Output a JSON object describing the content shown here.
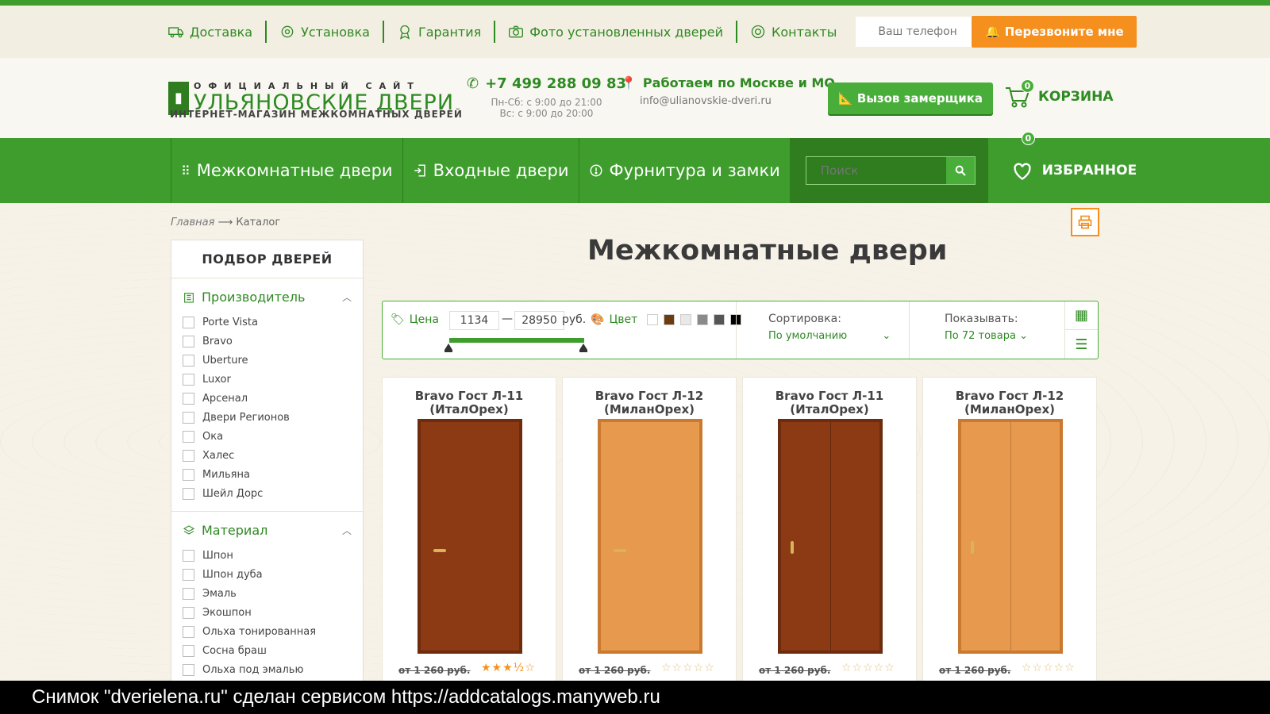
{
  "topnav": {
    "items": [
      {
        "label": "Доставка",
        "icon": "truck-icon"
      },
      {
        "label": "Установка",
        "icon": "gear-icon"
      },
      {
        "label": "Гарантия",
        "icon": "award-icon"
      },
      {
        "label": "Фото установленных дверей",
        "icon": "camera-icon"
      },
      {
        "label": "Контакты",
        "icon": "at-icon"
      }
    ],
    "phone_placeholder": "Ваш телефон",
    "callback_label": "Перезвоните мне"
  },
  "logo": {
    "top": "ОФИЦИАЛЬНЫЙ САЙТ",
    "main": "УЛЬЯНОВСКИЕ ДВЕРИ",
    "sub": "ИНТЕРНЕТ-МАГАЗИН МЕЖКОМНАТНЫХ ДВЕРЕЙ"
  },
  "contact": {
    "phone": "+7 499 288 09 83",
    "hours1": "Пн-Сб: с 9:00 до 21:00",
    "hours2": "Вс: с 9:00 до 20:00"
  },
  "address": {
    "title": "Работаем по Москве и МО",
    "email": "info@ulianovskie-dveri.ru"
  },
  "measure_label": "Вызов замерщика",
  "cart": {
    "label": "КОРЗИНА",
    "count": "0"
  },
  "mainnav": {
    "items": [
      "Межкомнатные двери",
      "Входные двери",
      "Фурнитура и замки"
    ],
    "search_placeholder": "Поиск",
    "fav_label": "ИЗБРАННОЕ",
    "fav_count": "0"
  },
  "breadcrumb": {
    "home": "Главная",
    "arrow": "⟶",
    "current": "Каталог"
  },
  "sidebar": {
    "title": "ПОДБОР ДВЕРЕЙ",
    "sections": [
      {
        "title": "Производитель",
        "options": [
          "Porte Vista",
          "Bravo",
          "Uberture",
          "Luxor",
          "Арсенал",
          "Двери Регионов",
          "Ока",
          "Халес",
          "Мильяна",
          "Шейл Дорс"
        ]
      },
      {
        "title": "Материал",
        "options": [
          "Шпон",
          "Шпон дуба",
          "Эмаль",
          "Экошпон",
          "Ольха тонированная",
          "Сосна браш",
          "Ольха под эмалью"
        ]
      }
    ]
  },
  "page_title": "Межкомнатные двери",
  "filters": {
    "price_label": "Цена",
    "price_min": "1134",
    "dash": "—",
    "price_max": "28950",
    "currency": "руб.",
    "color_label": "Цвет",
    "swatches": [
      "#ffffff",
      "#6b3c12",
      "#e8e8e8",
      "#8a8a8a",
      "#555555",
      "#000000"
    ],
    "sort_label": "Сортировка:",
    "sort_value": "По умолчанию",
    "show_label": "Показывать:",
    "show_value": "По 72 товара"
  },
  "products": [
    {
      "name1": "Bravo Гост Л-11",
      "name2": "(ИталОрех)",
      "price": "от 1 260 руб.",
      "door_color": "#8c3a14",
      "frame_color": "#6e2c0e",
      "stars": "★★★½☆"
    },
    {
      "name1": "Bravo Гост Л-12",
      "name2": "(МиланОрех)",
      "price": "от 1 260 руб.",
      "door_color": "#e79a4d",
      "frame_color": "#c97a30",
      "stars": "☆☆☆☆☆"
    },
    {
      "name1": "Bravo Гост Л-11",
      "name2": "(ИталОрех)",
      "price": "от 1 260 руб.",
      "door_color": "#8c3a14",
      "frame_color": "#6e2c0e",
      "stars": "☆☆☆☆☆"
    },
    {
      "name1": "Bravo Гост Л-12",
      "name2": "(МиланОрех)",
      "price": "от 1 260 руб.",
      "door_color": "#e79a4d",
      "frame_color": "#c97a30",
      "stars": "☆☆☆☆☆"
    }
  ],
  "footer_text": "Снимок \"dverielena.ru\" сделан сервисом https://addcatalogs.manyweb.ru",
  "colors": {
    "green": "#3e9d2d",
    "dark_green": "#2f7d1f",
    "orange": "#f5901e"
  }
}
